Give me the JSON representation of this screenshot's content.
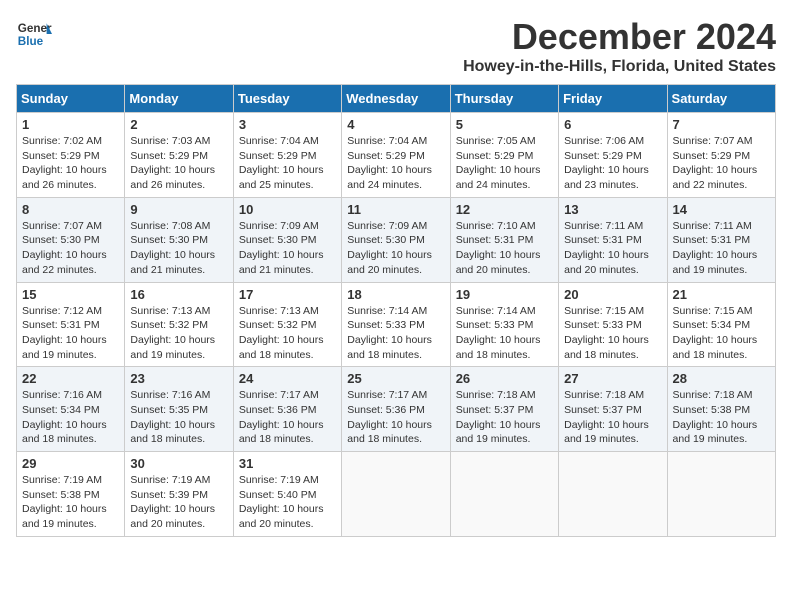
{
  "logo": {
    "line1": "General",
    "line2": "Blue"
  },
  "title": "December 2024",
  "location": "Howey-in-the-Hills, Florida, United States",
  "days_of_week": [
    "Sunday",
    "Monday",
    "Tuesday",
    "Wednesday",
    "Thursday",
    "Friday",
    "Saturday"
  ],
  "weeks": [
    [
      {
        "day": "1",
        "sunrise": "7:02 AM",
        "sunset": "5:29 PM",
        "daylight": "10 hours and 26 minutes."
      },
      {
        "day": "2",
        "sunrise": "7:03 AM",
        "sunset": "5:29 PM",
        "daylight": "10 hours and 26 minutes."
      },
      {
        "day": "3",
        "sunrise": "7:04 AM",
        "sunset": "5:29 PM",
        "daylight": "10 hours and 25 minutes."
      },
      {
        "day": "4",
        "sunrise": "7:04 AM",
        "sunset": "5:29 PM",
        "daylight": "10 hours and 24 minutes."
      },
      {
        "day": "5",
        "sunrise": "7:05 AM",
        "sunset": "5:29 PM",
        "daylight": "10 hours and 24 minutes."
      },
      {
        "day": "6",
        "sunrise": "7:06 AM",
        "sunset": "5:29 PM",
        "daylight": "10 hours and 23 minutes."
      },
      {
        "day": "7",
        "sunrise": "7:07 AM",
        "sunset": "5:29 PM",
        "daylight": "10 hours and 22 minutes."
      }
    ],
    [
      {
        "day": "8",
        "sunrise": "7:07 AM",
        "sunset": "5:30 PM",
        "daylight": "10 hours and 22 minutes."
      },
      {
        "day": "9",
        "sunrise": "7:08 AM",
        "sunset": "5:30 PM",
        "daylight": "10 hours and 21 minutes."
      },
      {
        "day": "10",
        "sunrise": "7:09 AM",
        "sunset": "5:30 PM",
        "daylight": "10 hours and 21 minutes."
      },
      {
        "day": "11",
        "sunrise": "7:09 AM",
        "sunset": "5:30 PM",
        "daylight": "10 hours and 20 minutes."
      },
      {
        "day": "12",
        "sunrise": "7:10 AM",
        "sunset": "5:31 PM",
        "daylight": "10 hours and 20 minutes."
      },
      {
        "day": "13",
        "sunrise": "7:11 AM",
        "sunset": "5:31 PM",
        "daylight": "10 hours and 20 minutes."
      },
      {
        "day": "14",
        "sunrise": "7:11 AM",
        "sunset": "5:31 PM",
        "daylight": "10 hours and 19 minutes."
      }
    ],
    [
      {
        "day": "15",
        "sunrise": "7:12 AM",
        "sunset": "5:31 PM",
        "daylight": "10 hours and 19 minutes."
      },
      {
        "day": "16",
        "sunrise": "7:13 AM",
        "sunset": "5:32 PM",
        "daylight": "10 hours and 19 minutes."
      },
      {
        "day": "17",
        "sunrise": "7:13 AM",
        "sunset": "5:32 PM",
        "daylight": "10 hours and 18 minutes."
      },
      {
        "day": "18",
        "sunrise": "7:14 AM",
        "sunset": "5:33 PM",
        "daylight": "10 hours and 18 minutes."
      },
      {
        "day": "19",
        "sunrise": "7:14 AM",
        "sunset": "5:33 PM",
        "daylight": "10 hours and 18 minutes."
      },
      {
        "day": "20",
        "sunrise": "7:15 AM",
        "sunset": "5:33 PM",
        "daylight": "10 hours and 18 minutes."
      },
      {
        "day": "21",
        "sunrise": "7:15 AM",
        "sunset": "5:34 PM",
        "daylight": "10 hours and 18 minutes."
      }
    ],
    [
      {
        "day": "22",
        "sunrise": "7:16 AM",
        "sunset": "5:34 PM",
        "daylight": "10 hours and 18 minutes."
      },
      {
        "day": "23",
        "sunrise": "7:16 AM",
        "sunset": "5:35 PM",
        "daylight": "10 hours and 18 minutes."
      },
      {
        "day": "24",
        "sunrise": "7:17 AM",
        "sunset": "5:36 PM",
        "daylight": "10 hours and 18 minutes."
      },
      {
        "day": "25",
        "sunrise": "7:17 AM",
        "sunset": "5:36 PM",
        "daylight": "10 hours and 18 minutes."
      },
      {
        "day": "26",
        "sunrise": "7:18 AM",
        "sunset": "5:37 PM",
        "daylight": "10 hours and 19 minutes."
      },
      {
        "day": "27",
        "sunrise": "7:18 AM",
        "sunset": "5:37 PM",
        "daylight": "10 hours and 19 minutes."
      },
      {
        "day": "28",
        "sunrise": "7:18 AM",
        "sunset": "5:38 PM",
        "daylight": "10 hours and 19 minutes."
      }
    ],
    [
      {
        "day": "29",
        "sunrise": "7:19 AM",
        "sunset": "5:38 PM",
        "daylight": "10 hours and 19 minutes."
      },
      {
        "day": "30",
        "sunrise": "7:19 AM",
        "sunset": "5:39 PM",
        "daylight": "10 hours and 20 minutes."
      },
      {
        "day": "31",
        "sunrise": "7:19 AM",
        "sunset": "5:40 PM",
        "daylight": "10 hours and 20 minutes."
      },
      null,
      null,
      null,
      null
    ]
  ]
}
